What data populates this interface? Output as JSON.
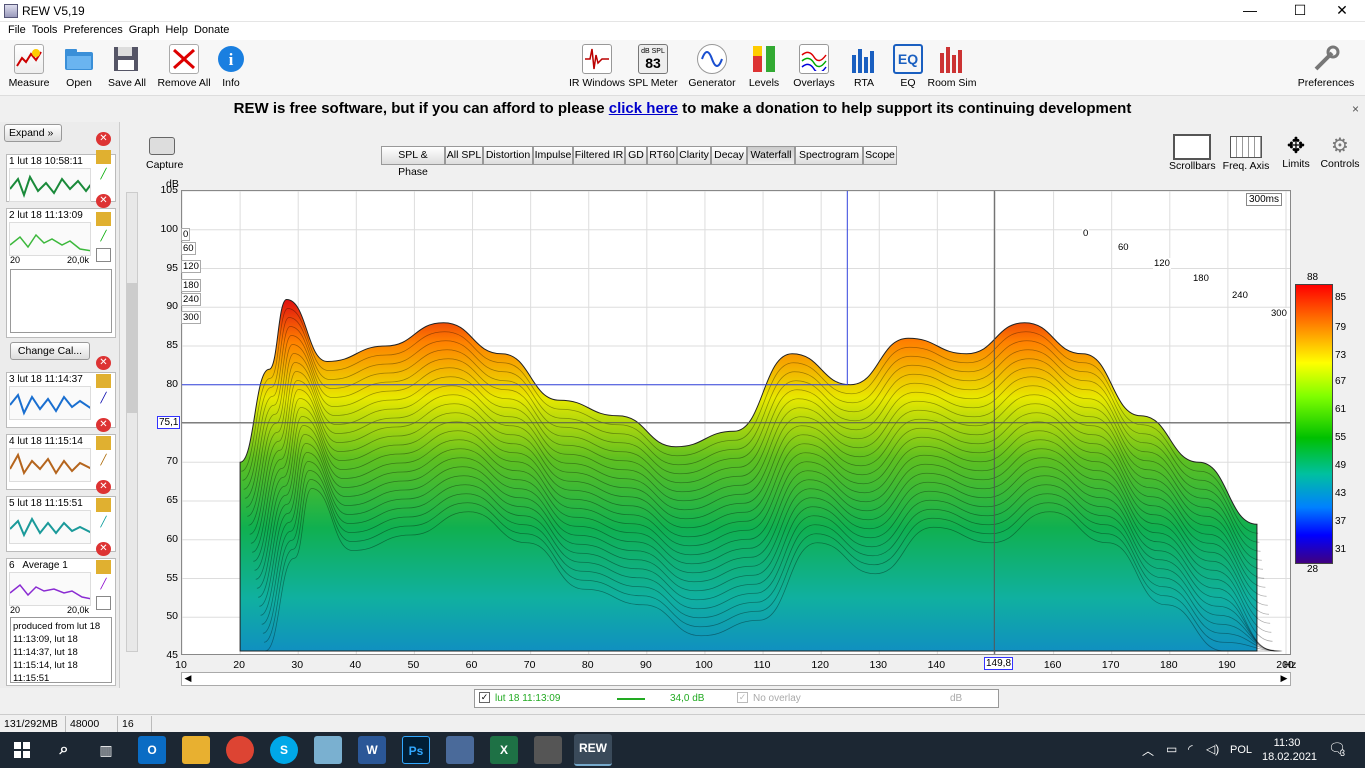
{
  "window": {
    "title": "REW V5,19",
    "minimize": "—",
    "maximize": "☐",
    "close": "✕"
  },
  "menu": [
    "File",
    "Tools",
    "Preferences",
    "Graph",
    "Help",
    "Donate"
  ],
  "toolbar": {
    "measure": "Measure",
    "open": "Open",
    "save_all": "Save All",
    "remove_all": "Remove All",
    "info": "Info",
    "ir_windows": "IR Windows",
    "spl_meter": "SPL Meter",
    "spl_meter_value": "83",
    "spl_meter_tag": "dB SPL",
    "generator": "Generator",
    "levels": "Levels",
    "overlays": "Overlays",
    "rta": "RTA",
    "eq": "EQ",
    "room_sim": "Room Sim",
    "preferences": "Preferences"
  },
  "banner": {
    "text_before": "REW is free software, but if you can afford to please",
    "link": "click here",
    "text_after": "to make a donation to help support its continuing development",
    "close": "×"
  },
  "left_panel": {
    "expand": "Expand",
    "measurements": [
      {
        "num": "1",
        "name": "lut 18 10:58:11",
        "color": "#1a8a3a"
      },
      {
        "num": "2",
        "name": "lut 18 11:13:09",
        "color": "#3cb83c",
        "axis_left": "20",
        "axis_right": "20,0k"
      },
      {
        "num": "3",
        "name": "lut 18 11:14:37",
        "color": "#1a6fd0"
      },
      {
        "num": "4",
        "name": "lut 18 11:15:14",
        "color": "#b5651d"
      },
      {
        "num": "5",
        "name": "lut 18 11:15:51",
        "color": "#1a9a9a"
      },
      {
        "num": "6",
        "name": "Average 1",
        "color": "#8a2bd2",
        "axis_left": "20",
        "axis_right": "20,0k"
      }
    ],
    "change_cal": "Change Cal...",
    "notes": "produced from lut 18 11:13:09, lut 18 11:14:37, lut 18 11:15:14, lut 18 11:15:51"
  },
  "graph": {
    "capture": "Capture",
    "tabs": [
      "SPL & Phase",
      "All SPL",
      "Distortion",
      "Impulse",
      "Filtered IR",
      "GD",
      "RT60",
      "Clarity",
      "Decay",
      "Waterfall",
      "Spectrogram",
      "Scope"
    ],
    "active_tab": "Waterfall",
    "right_buttons": [
      "Scrollbars",
      "Freq. Axis",
      "Limits",
      "Controls"
    ],
    "y_unit": "dB",
    "time_label": "300ms",
    "cursor_db": "75,1",
    "cursor_hz": "149,8",
    "x_unit": "Hz",
    "time_ticks_left": [
      "0",
      "60",
      "120",
      "180",
      "240",
      "300"
    ],
    "time_ticks_right": [
      "0",
      "60",
      "120",
      "180",
      "240",
      "300"
    ],
    "legend": {
      "name": "lut 18 11:13:09",
      "value": "34,0 dB",
      "overlay": "No overlay",
      "unit": "dB"
    }
  },
  "chart_data": {
    "type": "heatmap",
    "title": "",
    "xlabel": "Hz",
    "ylabel": "dB",
    "xlim": [
      10,
      200
    ],
    "ylim": [
      45,
      105
    ],
    "x_ticks": [
      "10",
      "20",
      "30",
      "40",
      "50",
      "60",
      "70",
      "80",
      "90",
      "100",
      "110",
      "120",
      "130",
      "140",
      "150",
      "160",
      "170",
      "180",
      "190",
      "200"
    ],
    "y_ticks": [
      "105",
      "100",
      "95",
      "90",
      "85",
      "80",
      "75",
      "70",
      "65",
      "60",
      "55",
      "50",
      "45"
    ],
    "colorbar_ticks": [
      "88",
      "85",
      "79",
      "73",
      "67",
      "61",
      "55",
      "49",
      "43",
      "37",
      "31",
      "28"
    ],
    "series": [
      {
        "name": "lut 18 11:13:09",
        "x": [
          20,
          25,
          28,
          35,
          45,
          55,
          65,
          75,
          85,
          95,
          105,
          115,
          125,
          135,
          145,
          155,
          165,
          175,
          185,
          195
        ],
        "values": [
          70,
          82,
          91,
          83,
          85,
          88,
          84,
          78,
          76,
          72,
          74,
          84,
          80,
          86,
          84,
          88,
          84,
          76,
          70,
          62
        ]
      }
    ]
  },
  "status": {
    "memory": "131/292MB",
    "rate": "48000 Hz",
    "bits": "16 Bit"
  },
  "taskbar": {
    "lang": "POL",
    "time": "11:30",
    "date": "18.02.2021",
    "notif": "3"
  }
}
